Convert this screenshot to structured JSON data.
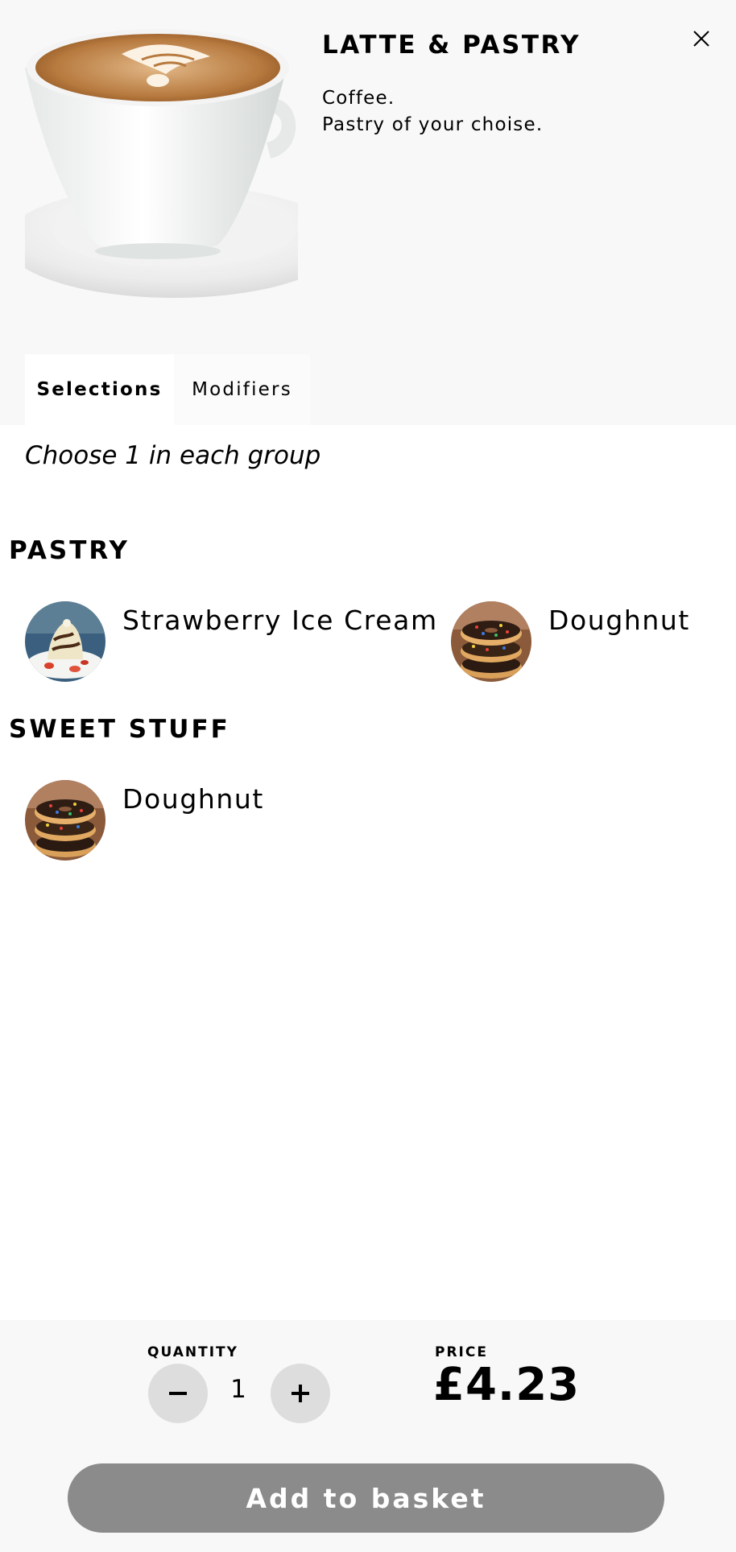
{
  "product": {
    "title": "LATTE & PASTRY",
    "description_line1": "Coffee.",
    "description_line2": "Pastry of your choise.",
    "image": "latte-cup-image"
  },
  "close_icon": "close-icon",
  "tabs": [
    {
      "label": "Selections",
      "active": true
    },
    {
      "label": "Modifiers",
      "active": false
    }
  ],
  "instruction": "Choose 1 in each group",
  "groups": [
    {
      "title": "PASTRY",
      "options": [
        {
          "label": "Strawberry Ice Cream",
          "image": "ice-cream-image"
        },
        {
          "label": "Doughnut",
          "image": "doughnut-image"
        }
      ]
    },
    {
      "title": "SWEET STUFF",
      "options": [
        {
          "label": "Doughnut",
          "image": "doughnut-image"
        }
      ]
    }
  ],
  "footer": {
    "quantity_label": "QUANTITY",
    "quantity_value": "1",
    "minus_icon": "minus-icon",
    "plus_icon": "plus-icon",
    "price_label": "PRICE",
    "price_value": "£4.23",
    "add_button_label": "Add to basket",
    "add_button_color": "#8b8b8b"
  },
  "colors": {
    "header_bg": "#f8f8f8",
    "footer_bg": "#f8f8f8",
    "qty_button_bg": "#dddddd"
  }
}
